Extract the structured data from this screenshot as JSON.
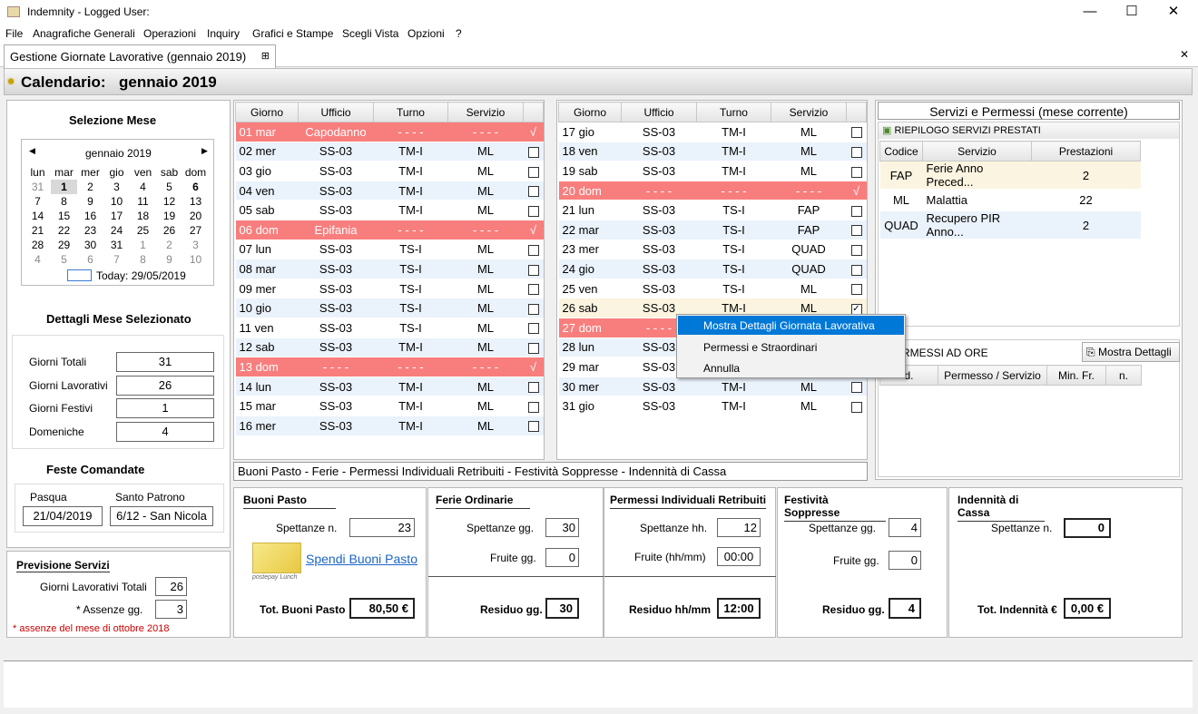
{
  "window": {
    "title": "Indemnity - Logged User:"
  },
  "menu": [
    "File",
    "Anagrafiche Generali",
    "Operazioni",
    "Inquiry",
    "Grafici e Stampe",
    "Scegli Vista",
    "Opzioni",
    "?"
  ],
  "tab": {
    "label": "Gestione Giornate Lavorative (gennaio 2019)"
  },
  "header": {
    "prefix": "Calendario:",
    "month": "gennaio 2019"
  },
  "selezione": {
    "title": "Selezione Mese",
    "cal_month": "gennaio 2019",
    "days": [
      "lun",
      "mar",
      "mer",
      "gio",
      "ven",
      "sab",
      "dom"
    ],
    "weeks": [
      [
        "31",
        "1",
        "2",
        "3",
        "4",
        "5",
        "6"
      ],
      [
        "7",
        "8",
        "9",
        "10",
        "11",
        "12",
        "13"
      ],
      [
        "14",
        "15",
        "16",
        "17",
        "18",
        "19",
        "20"
      ],
      [
        "21",
        "22",
        "23",
        "24",
        "25",
        "26",
        "27"
      ],
      [
        "28",
        "29",
        "30",
        "31",
        "1",
        "2",
        "3"
      ],
      [
        "4",
        "5",
        "6",
        "7",
        "8",
        "9",
        "10"
      ]
    ],
    "today": "Today: 29/05/2019"
  },
  "dettagli": {
    "title": "Dettagli Mese Selezionato",
    "rows": [
      {
        "label": "Giorni Totali",
        "value": "31"
      },
      {
        "label": "Giorni Lavorativi",
        "value": "26"
      },
      {
        "label": "Giorni Festivi",
        "value": "1"
      },
      {
        "label": "Domeniche",
        "value": "4"
      }
    ]
  },
  "feste": {
    "title": "Feste Comandate",
    "pasqua_label": "Pasqua",
    "pasqua": "21/04/2019",
    "patrono_label": "Santo Patrono",
    "patrono": "6/12 - San Nicola"
  },
  "previsione": {
    "title": "Previsione Servizi",
    "giorni_label": "Giorni Lavorativi Totali",
    "giorni": "26",
    "assenze_label": "*  Assenze   gg.",
    "assenze": "3",
    "note": "*  assenze del mese di ottobre 2018"
  },
  "columns": [
    "Giorno",
    "Ufficio",
    "Turno",
    "Servizio"
  ],
  "days_left": [
    {
      "g": "01 mar",
      "u": "Capodanno",
      "t": "- - - -",
      "s": "- - - -",
      "hol": true,
      "chk": "√"
    },
    {
      "g": "02 mer",
      "u": "SS-03",
      "t": "TM-I",
      "s": "ML"
    },
    {
      "g": "03 gio",
      "u": "SS-03",
      "t": "TM-I",
      "s": "ML"
    },
    {
      "g": "04 ven",
      "u": "SS-03",
      "t": "TM-I",
      "s": "ML"
    },
    {
      "g": "05 sab",
      "u": "SS-03",
      "t": "TM-I",
      "s": "ML"
    },
    {
      "g": "06 dom",
      "u": "Epifania",
      "t": "- - - -",
      "s": "- - - -",
      "hol": true,
      "chk": "√"
    },
    {
      "g": "07 lun",
      "u": "SS-03",
      "t": "TS-I",
      "s": "ML"
    },
    {
      "g": "08 mar",
      "u": "SS-03",
      "t": "TS-I",
      "s": "ML"
    },
    {
      "g": "09 mer",
      "u": "SS-03",
      "t": "TS-I",
      "s": "ML"
    },
    {
      "g": "10 gio",
      "u": "SS-03",
      "t": "TS-I",
      "s": "ML"
    },
    {
      "g": "11 ven",
      "u": "SS-03",
      "t": "TS-I",
      "s": "ML"
    },
    {
      "g": "12 sab",
      "u": "SS-03",
      "t": "TM-I",
      "s": "ML"
    },
    {
      "g": "13 dom",
      "u": "- - - -",
      "t": "- - - -",
      "s": "- - - -",
      "hol": true,
      "chk": "√"
    },
    {
      "g": "14 lun",
      "u": "SS-03",
      "t": "TM-I",
      "s": "ML"
    },
    {
      "g": "15 mar",
      "u": "SS-03",
      "t": "TM-I",
      "s": "ML"
    },
    {
      "g": "16 mer",
      "u": "SS-03",
      "t": "TM-I",
      "s": "ML"
    }
  ],
  "days_right": [
    {
      "g": "17 gio",
      "u": "SS-03",
      "t": "TM-I",
      "s": "ML"
    },
    {
      "g": "18 ven",
      "u": "SS-03",
      "t": "TM-I",
      "s": "ML"
    },
    {
      "g": "19 sab",
      "u": "SS-03",
      "t": "TM-I",
      "s": "ML"
    },
    {
      "g": "20 dom",
      "u": "- - - -",
      "t": "- - - -",
      "s": "- - - -",
      "hol": true,
      "chk": "√"
    },
    {
      "g": "21 lun",
      "u": "SS-03",
      "t": "TS-I",
      "s": "FAP"
    },
    {
      "g": "22 mar",
      "u": "SS-03",
      "t": "TS-I",
      "s": "FAP"
    },
    {
      "g": "23 mer",
      "u": "SS-03",
      "t": "TS-I",
      "s": "QUAD"
    },
    {
      "g": "24 gio",
      "u": "SS-03",
      "t": "TS-I",
      "s": "QUAD"
    },
    {
      "g": "25 ven",
      "u": "SS-03",
      "t": "TS-I",
      "s": "ML"
    },
    {
      "g": "26 sab",
      "u": "SS-03",
      "t": "TM-I",
      "s": "ML",
      "sel": true,
      "chk": "✓"
    },
    {
      "g": "27 dom",
      "u": "- - - -",
      "t": "",
      "s": "",
      "hol": true
    },
    {
      "g": "28 lun",
      "u": "SS-03",
      "t": "",
      "s": ""
    },
    {
      "g": "29 mar",
      "u": "SS-03",
      "t": "",
      "s": ""
    },
    {
      "g": "30 mer",
      "u": "SS-03",
      "t": "TM-I",
      "s": "ML"
    },
    {
      "g": "31 gio",
      "u": "SS-03",
      "t": "TM-I",
      "s": "ML"
    }
  ],
  "servizi": {
    "title": "Servizi  e  Permessi (mese corrente)",
    "riepilogo": "RIEPILOGO SERVIZI PRESTATI",
    "cols": [
      "Codice",
      "Servizio",
      "Prestazioni"
    ],
    "rows": [
      {
        "c": "FAP",
        "s": "Ferie Anno Preced...",
        "p": "2"
      },
      {
        "c": "ML",
        "s": "Malattia",
        "p": "22"
      },
      {
        "c": "QUAD",
        "s": "Recupero PIR Anno...",
        "p": "2"
      }
    ],
    "permessi": "RMESSI AD ORE",
    "dettagli_btn": "Mostra Dettagli",
    "pcols": [
      "d.",
      "Permesso / Servizio",
      "Min. Fr.",
      "n."
    ]
  },
  "context_menu": [
    "Mostra Dettagli Giornata Lavorativa",
    "Permessi e Straordinari",
    "Annulla"
  ],
  "footer_title": "Buoni Pasto - Ferie - Permessi Individuali Retribuiti - Festività Soppresse - Indennità di Cassa",
  "buoni": {
    "title": "Buoni Pasto",
    "spett_label": "Spettanze n.",
    "spett": "23",
    "link": "Spendi Buoni Pasto",
    "tot_label": "Tot. Buoni Pasto",
    "tot": "80,50 €",
    "card_text": "postepay Lunch"
  },
  "ferie": {
    "title": "Ferie Ordinarie",
    "spett_label": "Spettanze gg.",
    "spett": "30",
    "fruite_label": "Fruite gg.",
    "fruite": "0",
    "res_label": "Residuo gg.",
    "res": "30"
  },
  "permessi": {
    "title": "Permessi Individuali Retribuiti",
    "spett_label": "Spettanze hh.",
    "spett": "12",
    "fruite_label": "Fruite (hh/mm)",
    "fruite": "00:00",
    "res_label": "Residuo hh/mm",
    "res": "12:00"
  },
  "festivita": {
    "title": "Festività Soppresse",
    "spett_label": "Spettanze gg.",
    "spett": "4",
    "fruite_label": "Fruite gg.",
    "fruite": "0",
    "res_label": "Residuo gg.",
    "res": "4"
  },
  "indennita": {
    "title": "Indennità di  Cassa",
    "spett_label": "Spettanze n.",
    "spett": "0",
    "tot_label": "Tot. Indennità €",
    "tot": "0,00 €"
  },
  "colors": {
    "holiday": "#f87e7e",
    "alt_row": "#eaf2fb",
    "selected_menu": "#0078d7"
  }
}
